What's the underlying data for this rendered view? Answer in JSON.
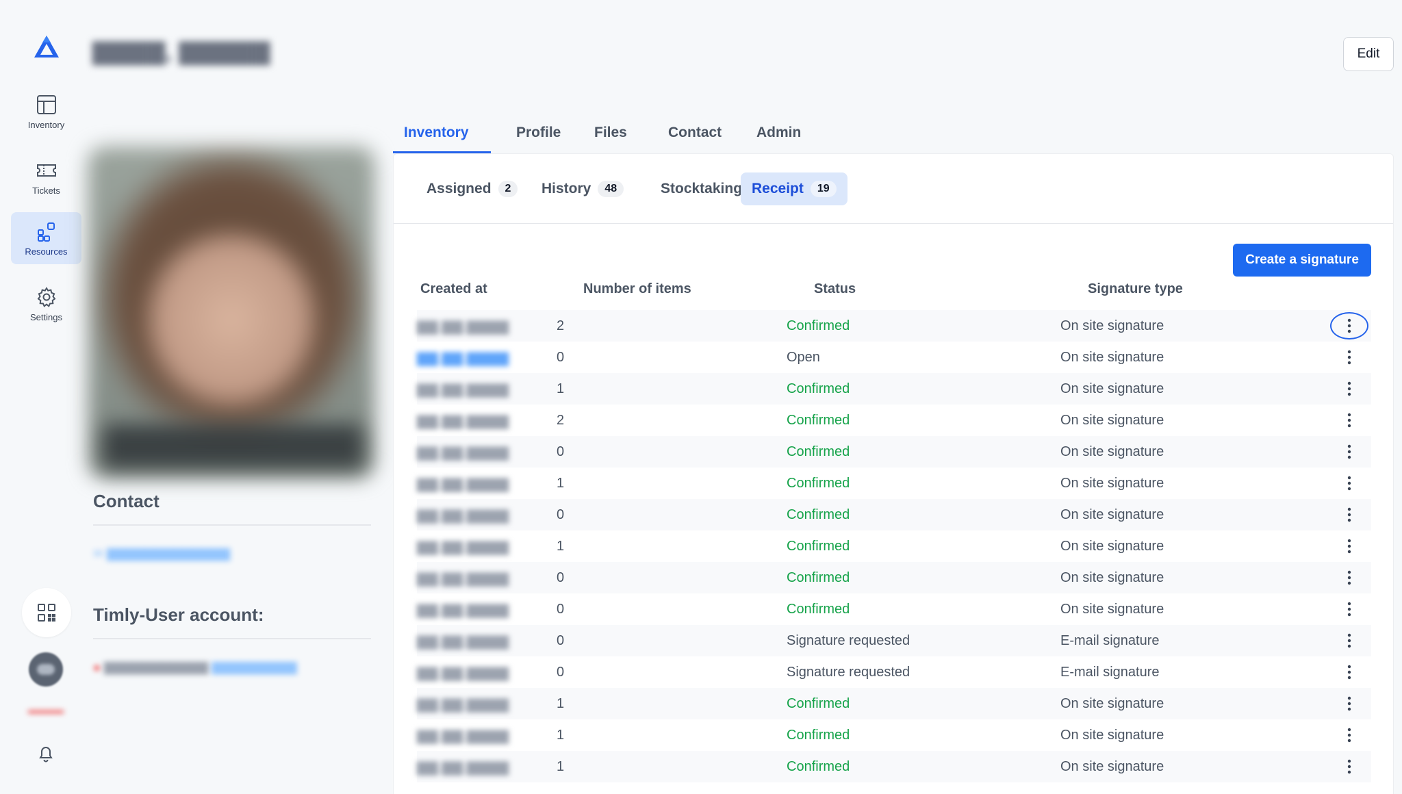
{
  "sidebar": {
    "items": [
      {
        "label": "Inventory",
        "icon": "table-grid-icon"
      },
      {
        "label": "Tickets",
        "icon": "ticket-icon"
      },
      {
        "label": "Resources",
        "icon": "resources-icon"
      },
      {
        "label": "Settings",
        "icon": "gear-icon"
      }
    ],
    "active_index": 2
  },
  "header": {
    "edit_label": "Edit"
  },
  "left": {
    "contact_title": "Contact",
    "account_title": "Timly-User account:"
  },
  "tabs": [
    {
      "label": "Inventory"
    },
    {
      "label": "Profile"
    },
    {
      "label": "Files"
    },
    {
      "label": "Contact"
    },
    {
      "label": "Admin"
    }
  ],
  "subtabs": [
    {
      "label": "Assigned",
      "count": "2"
    },
    {
      "label": "History",
      "count": "48"
    },
    {
      "label": "Stocktaking",
      "count": ""
    },
    {
      "label": "Receipt",
      "count": "19"
    }
  ],
  "create_button": "Create a signature",
  "table": {
    "headers": [
      "Created at",
      "Number of items",
      "Status",
      "Signature type"
    ],
    "rows": [
      {
        "items": "2",
        "status": "Confirmed",
        "type": "On site signature"
      },
      {
        "items": "0",
        "status": "Open",
        "type": "On site signature"
      },
      {
        "items": "1",
        "status": "Confirmed",
        "type": "On site signature"
      },
      {
        "items": "2",
        "status": "Confirmed",
        "type": "On site signature"
      },
      {
        "items": "0",
        "status": "Confirmed",
        "type": "On site signature"
      },
      {
        "items": "1",
        "status": "Confirmed",
        "type": "On site signature"
      },
      {
        "items": "0",
        "status": "Confirmed",
        "type": "On site signature"
      },
      {
        "items": "1",
        "status": "Confirmed",
        "type": "On site signature"
      },
      {
        "items": "0",
        "status": "Confirmed",
        "type": "On site signature"
      },
      {
        "items": "0",
        "status": "Confirmed",
        "type": "On site signature"
      },
      {
        "items": "0",
        "status": "Signature requested",
        "type": "E-mail signature"
      },
      {
        "items": "0",
        "status": "Signature requested",
        "type": "E-mail signature"
      },
      {
        "items": "1",
        "status": "Confirmed",
        "type": "On site signature"
      },
      {
        "items": "1",
        "status": "Confirmed",
        "type": "On site signature"
      },
      {
        "items": "1",
        "status": "Confirmed",
        "type": "On site signature"
      }
    ]
  },
  "colors": {
    "accent": "#2563eb",
    "confirmed": "#16a34a",
    "active_bg": "#dbe7fb"
  }
}
